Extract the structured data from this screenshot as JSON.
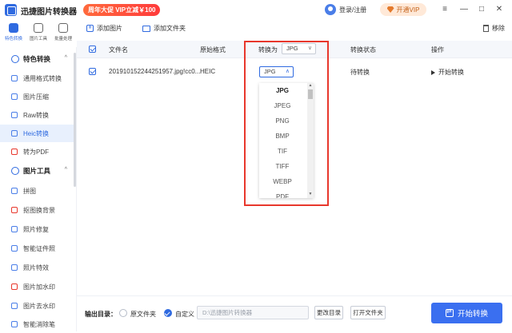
{
  "app": {
    "title": "迅捷图片转换器",
    "promo": "周年大促 VIP立减￥100",
    "login": "登录/注册",
    "vip_button": "开通VIP",
    "window_controls": [
      "≡",
      "—",
      "□",
      "✕"
    ]
  },
  "top_tabs": [
    {
      "label": "特色转换",
      "active": true
    },
    {
      "label": "图片工具",
      "active": false
    },
    {
      "label": "批量处理",
      "active": false
    }
  ],
  "sidebar": {
    "groups": [
      {
        "title": "特色转换",
        "items": [
          {
            "label": "通用格式转换",
            "active": false
          },
          {
            "label": "图片压缩",
            "active": false
          },
          {
            "label": "Raw转换",
            "active": false
          },
          {
            "label": "Heic转换",
            "active": true
          },
          {
            "label": "转为PDF",
            "active": false
          }
        ]
      },
      {
        "title": "图片工具",
        "items": [
          {
            "label": "拼图"
          },
          {
            "label": "抠图换背景"
          },
          {
            "label": "照片修复"
          },
          {
            "label": "智能证件照"
          },
          {
            "label": "照片特效"
          },
          {
            "label": "图片加水印"
          },
          {
            "label": "图片去水印"
          },
          {
            "label": "智能消除笔"
          }
        ]
      }
    ]
  },
  "toolbar": {
    "add_image": "添加图片",
    "add_folder": "添加文件夹",
    "remove": "移除"
  },
  "table": {
    "headers": {
      "filename": "文件名",
      "source_format": "原始格式",
      "convert_to": "转换为",
      "status": "转换状态",
      "action": "操作"
    },
    "header_format_value": "JPG",
    "rows": [
      {
        "filename": "20191015224425195​7.jpg!cc0...",
        "source_format": "HEIC",
        "target_format": "JPG",
        "status": "待转换",
        "action": "开始转换"
      }
    ]
  },
  "dropdown": {
    "options": [
      "JPG",
      "JPEG",
      "PNG",
      "BMP",
      "TIF",
      "TIFF",
      "WEBP",
      "PDF"
    ],
    "selected": "JPG"
  },
  "bottom": {
    "output_label": "输出目录：",
    "option_source": "原文件夹",
    "option_custom": "自定义",
    "path_placeholder": "D:\\迅捷图片转换器",
    "change_dir": "更改目录",
    "open_folder": "打开文件夹",
    "start_convert": "开始转换"
  },
  "colors": {
    "accent": "#2f6ae0",
    "highlight_box": "#e8372c",
    "start_button": "#3a6ff0"
  }
}
